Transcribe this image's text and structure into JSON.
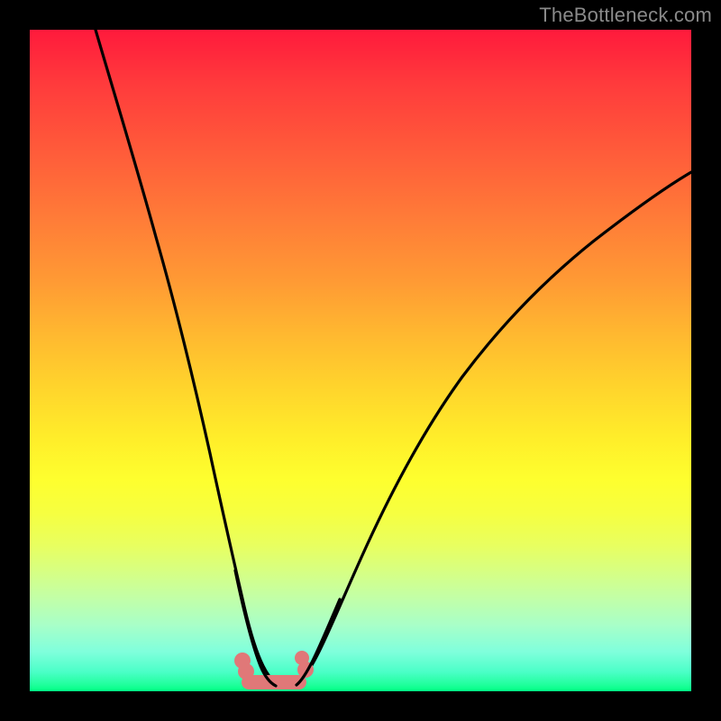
{
  "watermark": "TheBottleneck.com",
  "chart_data": {
    "type": "line",
    "title": "",
    "xlabel": "",
    "ylabel": "",
    "xlim": [
      0,
      100
    ],
    "ylim": [
      0,
      100
    ],
    "grid": false,
    "legend": false,
    "background_gradient": {
      "top_color": "#ff1a3c",
      "bottom_color": "#00ff84",
      "description": "vertical rainbow gradient red→orange→yellow→green"
    },
    "series": [
      {
        "name": "left-curve",
        "color": "#000000",
        "x": [
          10,
          12,
          14,
          16,
          18,
          20,
          22,
          24,
          26,
          28,
          29,
          30,
          31,
          32,
          33,
          34,
          35,
          36
        ],
        "y": [
          100,
          90,
          80,
          70,
          60,
          50,
          40,
          30,
          20,
          12,
          9,
          7,
          5.5,
          4,
          3,
          2.2,
          2,
          2
        ]
      },
      {
        "name": "right-curve",
        "color": "#000000",
        "x": [
          39,
          40,
          41,
          42,
          44,
          46,
          50,
          55,
          60,
          65,
          70,
          75,
          80,
          85,
          90,
          95,
          100
        ],
        "y": [
          2,
          2.2,
          3,
          4.5,
          8,
          12,
          20,
          30,
          38,
          45,
          51,
          56,
          61,
          65,
          69,
          72,
          75
        ]
      },
      {
        "name": "valley-marker",
        "type": "marker-band",
        "color": "#e07878",
        "x_range": [
          29,
          41
        ],
        "y_level": 4,
        "description": "salmon colored rounded band with two bumps at the trough of the V"
      }
    ],
    "annotations": []
  },
  "colors": {
    "frame": "#000000",
    "curve": "#000000",
    "marker": "#e07878",
    "watermark": "#8a8a8a"
  }
}
